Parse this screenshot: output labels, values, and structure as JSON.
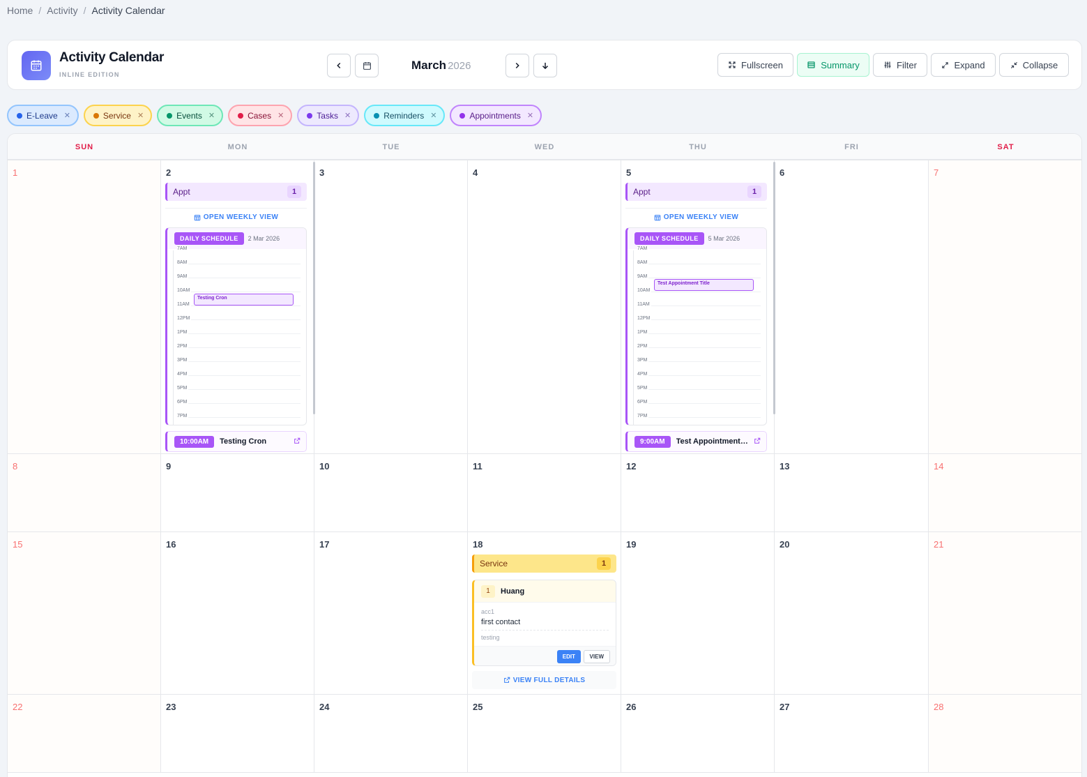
{
  "breadcrumb": {
    "home": "Home",
    "section": "Activity",
    "current": "Activity Calendar"
  },
  "header": {
    "title": "Activity Calendar",
    "subtitle": "INLINE EDITION",
    "month": "March",
    "year": "2026"
  },
  "toolbar": {
    "fullscreen": "Fullscreen",
    "summary": "Summary",
    "filter": "Filter",
    "expand": "Expand",
    "collapse": "Collapse"
  },
  "filters": [
    {
      "label": "E-Leave",
      "bg": "#dbeafe",
      "border": "#93c5fd",
      "dot": "#2563eb",
      "text": "#1e3a8a"
    },
    {
      "label": "Service",
      "bg": "#fef3c7",
      "border": "#fcd34d",
      "dot": "#d97706",
      "text": "#78350f"
    },
    {
      "label": "Events",
      "bg": "#d1fae5",
      "border": "#6ee7b7",
      "dot": "#059669",
      "text": "#064e3b"
    },
    {
      "label": "Cases",
      "bg": "#ffe4e6",
      "border": "#fda4af",
      "dot": "#e11d48",
      "text": "#881337"
    },
    {
      "label": "Tasks",
      "bg": "#ede9fe",
      "border": "#c4b5fd",
      "dot": "#7c3aed",
      "text": "#4c1d95"
    },
    {
      "label": "Reminders",
      "bg": "#cffafe",
      "border": "#67e8f9",
      "dot": "#0891b2",
      "text": "#164e63"
    },
    {
      "label": "Appointments",
      "bg": "#f3e8ff",
      "border": "#c084fc",
      "dot": "#9333ea",
      "text": "#581c87"
    }
  ],
  "weekdays": [
    "SUN",
    "MON",
    "TUE",
    "WED",
    "THU",
    "FRI",
    "SAT"
  ],
  "weeks": [
    [
      "1",
      "2",
      "3",
      "4",
      "5",
      "6",
      "7"
    ],
    [
      "8",
      "9",
      "10",
      "11",
      "12",
      "13",
      "14"
    ],
    [
      "15",
      "16",
      "17",
      "18",
      "19",
      "20",
      "21"
    ],
    [
      "22",
      "23",
      "24",
      "25",
      "26",
      "27",
      "28"
    ]
  ],
  "hours": [
    "7AM",
    "8AM",
    "9AM",
    "10AM",
    "11AM",
    "12PM",
    "1PM",
    "2PM",
    "3PM",
    "4PM",
    "5PM",
    "6PM",
    "7PM"
  ],
  "day2": {
    "category": "Appt",
    "count": "1",
    "weekly_link": "OPEN WEEKLY VIEW",
    "schedule_label": "DAILY SCHEDULE",
    "schedule_date": "2 Mar 2026",
    "sched_event": "Testing Cron",
    "event_time": "10:00AM",
    "event_title": "Testing Cron"
  },
  "day5": {
    "category": "Appt",
    "count": "1",
    "weekly_link": "OPEN WEEKLY VIEW",
    "schedule_label": "DAILY SCHEDULE",
    "schedule_date": "5 Mar 2026",
    "sched_event": "Test Appointment Title",
    "event_time": "9:00AM",
    "event_title": "Test Appointment Title"
  },
  "day18": {
    "category": "Service",
    "count": "1",
    "card": {
      "num": "1",
      "name": "Huang",
      "account": "acc1",
      "subject": "first contact",
      "note": "testing",
      "edit": "EDIT",
      "view": "VIEW"
    },
    "details_link": "VIEW FULL DETAILS"
  },
  "colors": {
    "accent": "#6366f1",
    "appointment": "#a855f7",
    "service": "#fbbf24",
    "link": "#3b82f6",
    "weekend": "#e11d48"
  }
}
